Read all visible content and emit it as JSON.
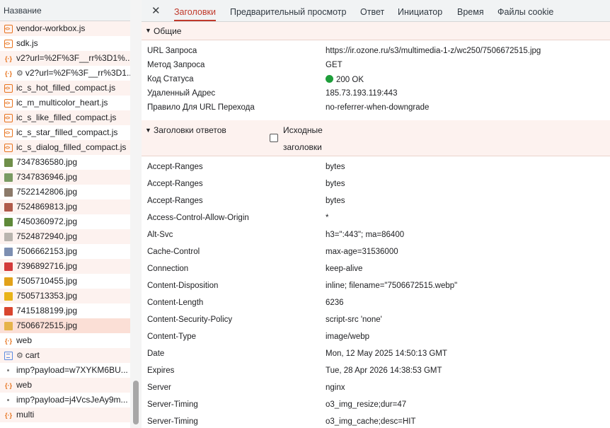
{
  "request_list": {
    "header": "Название",
    "items": [
      {
        "type": "js",
        "name": "vendor-workbox.js",
        "gear": false
      },
      {
        "type": "js",
        "name": "sdk.js",
        "gear": false
      },
      {
        "type": "fetch",
        "name": "v2?url=%2F%3F__rr%3D1%...",
        "gear": false
      },
      {
        "type": "fetch",
        "name": "v2?url=%2F%3F__rr%3D1...",
        "gear": true
      },
      {
        "type": "js",
        "name": "ic_s_hot_filled_compact.js",
        "gear": false
      },
      {
        "type": "js",
        "name": "ic_m_multicolor_heart.js",
        "gear": false
      },
      {
        "type": "js",
        "name": "ic_s_like_filled_compact.js",
        "gear": false
      },
      {
        "type": "js",
        "name": "ic_s_star_filled_compact.js",
        "gear": false
      },
      {
        "type": "js",
        "name": "ic_s_dialog_filled_compact.js",
        "gear": false
      },
      {
        "type": "img",
        "name": "7347836580.jpg",
        "color": "#6f8f4a",
        "gear": false
      },
      {
        "type": "img",
        "name": "7347836946.jpg",
        "color": "#7a9a62",
        "gear": false
      },
      {
        "type": "img",
        "name": "7522142806.jpg",
        "color": "#8c7a6a",
        "gear": false
      },
      {
        "type": "img",
        "name": "7524869813.jpg",
        "color": "#b05a4a",
        "gear": false
      },
      {
        "type": "img",
        "name": "7450360972.jpg",
        "color": "#5f8a3a",
        "gear": false
      },
      {
        "type": "img",
        "name": "7524872940.jpg",
        "color": "#b9b4ae",
        "gear": false
      },
      {
        "type": "img",
        "name": "7506662153.jpg",
        "color": "#7d8fb2",
        "gear": false
      },
      {
        "type": "img",
        "name": "7396892716.jpg",
        "color": "#d33a3a",
        "gear": false
      },
      {
        "type": "img",
        "name": "7505710455.jpg",
        "color": "#e2a21a",
        "gear": false
      },
      {
        "type": "img",
        "name": "7505713353.jpg",
        "color": "#e9b318",
        "gear": false
      },
      {
        "type": "img",
        "name": "7415188199.jpg",
        "color": "#d9462f",
        "gear": false
      },
      {
        "type": "img",
        "name": "7506672515.jpg",
        "color": "#e6b34a",
        "gear": false,
        "selected": true
      },
      {
        "type": "fetch",
        "name": "web",
        "gear": false
      },
      {
        "type": "doc",
        "name": "cart",
        "gear": true
      },
      {
        "type": "dot",
        "name": "imp?payload=w7XYKM6BU...",
        "gear": false
      },
      {
        "type": "fetch",
        "name": "web",
        "gear": false
      },
      {
        "type": "dot",
        "name": "imp?payload=j4VcsJeAy9m...",
        "gear": false
      },
      {
        "type": "fetch",
        "name": "multi",
        "gear": false
      }
    ]
  },
  "tabs": [
    {
      "label": "Заголовки",
      "active": true
    },
    {
      "label": "Предварительный просмотр",
      "active": false
    },
    {
      "label": "Ответ",
      "active": false
    },
    {
      "label": "Инициатор",
      "active": false
    },
    {
      "label": "Время",
      "active": false
    },
    {
      "label": "Файлы cookie",
      "active": false
    }
  ],
  "general": {
    "title": "Общие",
    "rows": [
      {
        "key": "URL Запроса",
        "value": "https://ir.ozone.ru/s3/multimedia-1-z/wc250/7506672515.jpg"
      },
      {
        "key": "Метод Запроса",
        "value": "GET"
      },
      {
        "key": "Код Статуса",
        "value": "200 OK"
      },
      {
        "key": "Удаленный Адрес",
        "value": "185.73.193.119:443"
      },
      {
        "key": "Правило Для URL Перехода",
        "value": "no-referrer-when-downgrade"
      }
    ],
    "status_color": "#1e9e3a"
  },
  "response_headers": {
    "title": "Заголовки ответов",
    "raw_label_1": "Исходные",
    "raw_label_2": "заголовки",
    "rows": [
      {
        "key": "Accept-Ranges",
        "value": "bytes"
      },
      {
        "key": "Accept-Ranges",
        "value": "bytes"
      },
      {
        "key": "Accept-Ranges",
        "value": "bytes"
      },
      {
        "key": "Access-Control-Allow-Origin",
        "value": "*"
      },
      {
        "key": "Alt-Svc",
        "value": "h3=\":443\"; ma=86400"
      },
      {
        "key": "Cache-Control",
        "value": "max-age=31536000"
      },
      {
        "key": "Connection",
        "value": "keep-alive"
      },
      {
        "key": "Content-Disposition",
        "value": "inline; filename=\"7506672515.webp\""
      },
      {
        "key": "Content-Length",
        "value": "6236"
      },
      {
        "key": "Content-Security-Policy",
        "value": "script-src 'none'"
      },
      {
        "key": "Content-Type",
        "value": "image/webp"
      },
      {
        "key": "Date",
        "value": "Mon, 12 May 2025 14:50:13 GMT"
      },
      {
        "key": "Expires",
        "value": "Tue, 28 Apr 2026 14:38:53 GMT"
      },
      {
        "key": "Server",
        "value": "nginx"
      },
      {
        "key": "Server-Timing",
        "value": "o3_img_resize;dur=47"
      },
      {
        "key": "Server-Timing",
        "value": "o3_img_cache;desc=HIT"
      }
    ]
  },
  "colors": {
    "accent": "#c0392b",
    "row_tint": "#fdf2ef",
    "selected_row": "#fbdfd6"
  }
}
